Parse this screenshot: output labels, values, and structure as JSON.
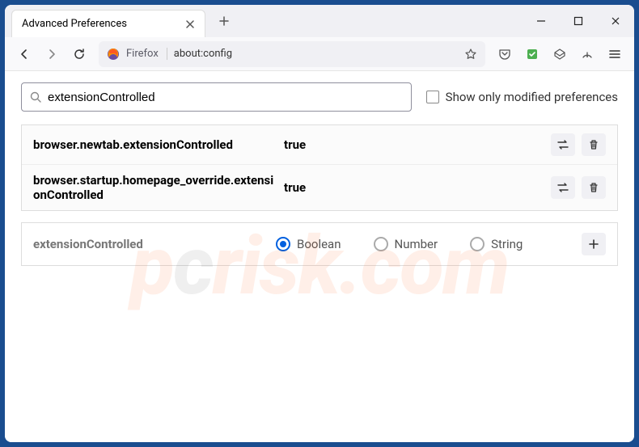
{
  "window": {
    "tab_title": "Advanced Preferences",
    "url": "about:config",
    "identity": "Firefox"
  },
  "search": {
    "value": "extensionControlled",
    "show_modified_label": "Show only modified preferences"
  },
  "prefs": [
    {
      "name": "browser.newtab.extensionControlled",
      "value": "true"
    },
    {
      "name": "browser.startup.homepage_override.extensionControlled",
      "value": "true"
    }
  ],
  "newpref": {
    "name": "extensionControlled",
    "types": {
      "boolean": "Boolean",
      "number": "Number",
      "string": "String"
    }
  },
  "watermark": {
    "p": "p",
    "c": "c",
    "rest": "risk.com"
  }
}
